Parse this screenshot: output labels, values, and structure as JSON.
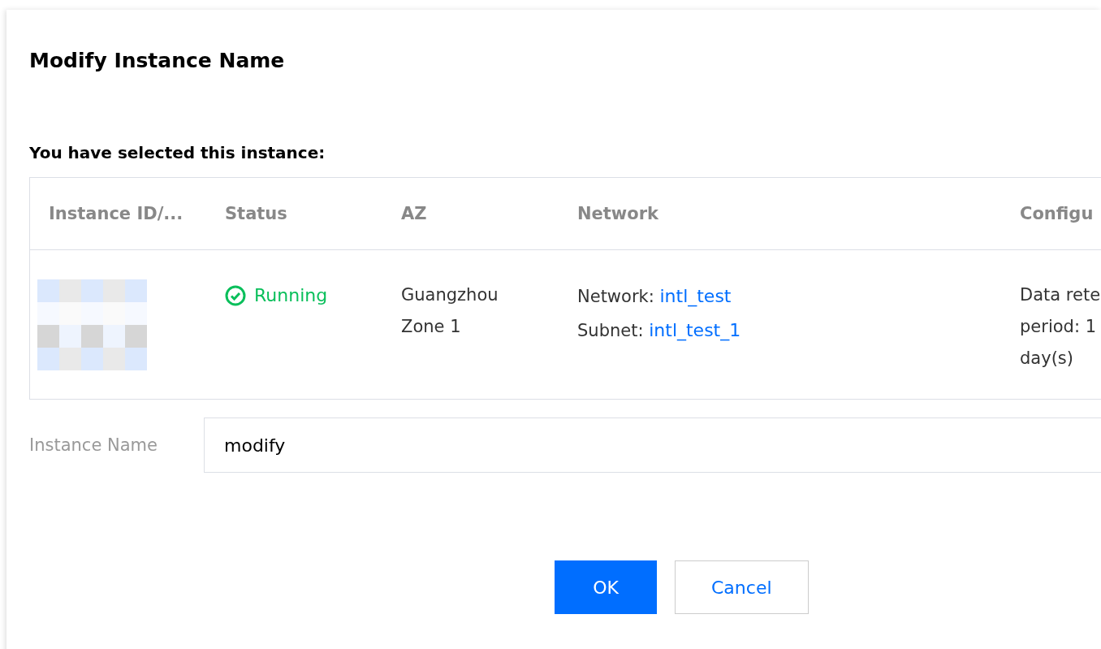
{
  "dialog": {
    "title": "Modify Instance Name",
    "subtitle": "You have selected this instance:"
  },
  "table": {
    "columns": [
      "Instance ID/...",
      "Status",
      "AZ",
      "Network",
      "Configu"
    ],
    "rows": [
      {
        "status": {
          "kind": "running",
          "label": "Running"
        },
        "az": "Guangzhou Zone 1",
        "network": {
          "network_label": "Network:",
          "network_link": "intl_test",
          "subnet_label": "Subnet:",
          "subnet_link": "intl_test_1"
        },
        "configuration_lines": [
          "Data rete",
          "period: 1",
          "day(s)"
        ]
      }
    ]
  },
  "form": {
    "label": "Instance Name",
    "value": "modify"
  },
  "buttons": [
    {
      "kind": "primary",
      "label": "OK"
    },
    {
      "kind": "secondary",
      "label": "Cancel"
    }
  ]
}
